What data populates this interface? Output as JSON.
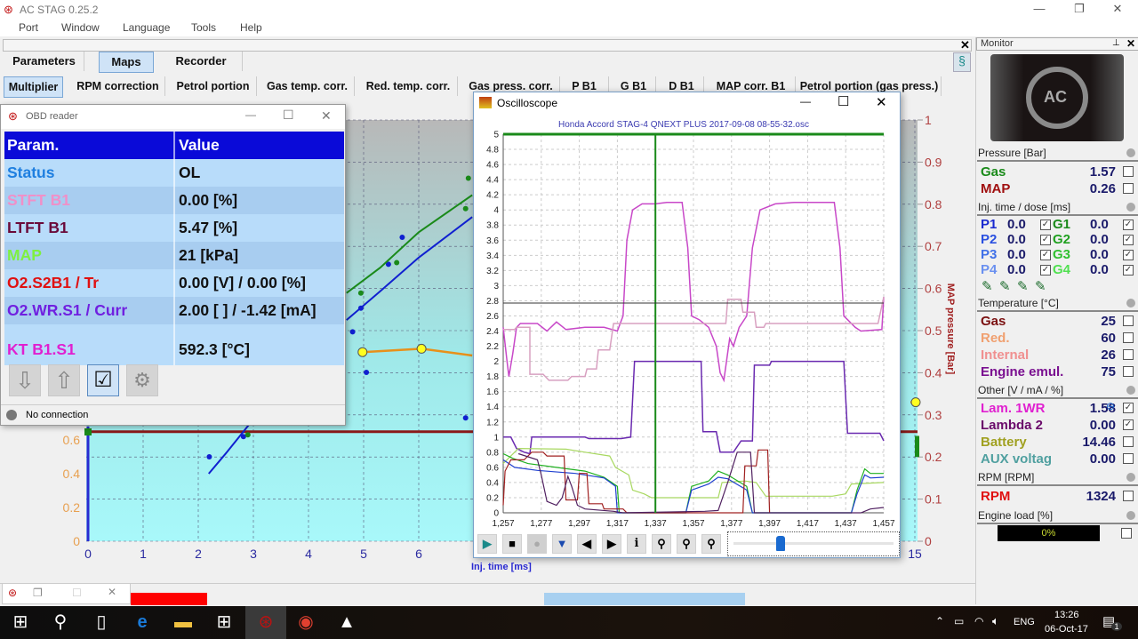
{
  "app": {
    "title": "AC STAG 0.25.2",
    "menu": [
      "Port",
      "Window",
      "Language",
      "Tools",
      "Help"
    ]
  },
  "tabs": [
    {
      "label": "Parameters"
    },
    {
      "label": "Maps",
      "selected": true
    },
    {
      "label": "Recorder"
    }
  ],
  "subtabs": [
    {
      "label": "Multiplier",
      "selected": true
    },
    {
      "label": "RPM correction"
    },
    {
      "label": "Petrol portion"
    },
    {
      "label": "Gas temp. corr."
    },
    {
      "label": "Red. temp. corr."
    },
    {
      "label": "Gas press. corr."
    },
    {
      "label": "P B1"
    },
    {
      "label": "G B1"
    },
    {
      "label": "D B1"
    },
    {
      "label": "MAP corr. B1"
    },
    {
      "label": "Petrol portion (gas press.)"
    }
  ],
  "map_chart": {
    "type": "scatter",
    "xlabel": "Inj. time [ms]",
    "y2label": "MAP pressure [Bar]",
    "xlim": [
      0,
      15
    ],
    "y2lim": [
      0,
      1
    ],
    "x_ticks": [
      "0",
      "1",
      "2",
      "3",
      "4",
      "5",
      "6",
      "15"
    ],
    "y_ticks": [
      "0",
      "0.2",
      "0.4",
      "0.6"
    ],
    "y2_ticks": [
      "0",
      "0.1",
      "0.2",
      "0.3",
      "0.4",
      "0.5",
      "0.6",
      "0.7",
      "0.8",
      "0.9",
      "1"
    ],
    "green_curve": [
      [
        4.69,
        1.47
      ],
      [
        5.3,
        1.62
      ],
      [
        6.0,
        1.83
      ],
      [
        6.97,
        2.05
      ]
    ],
    "blue_curve": [
      [
        4.69,
        1.31
      ],
      [
        5.3,
        1.48
      ],
      [
        6.0,
        1.68
      ],
      [
        6.97,
        1.92
      ]
    ],
    "blue_low_curve": [
      [
        2.19,
        0.4
      ],
      [
        2.5,
        0.52
      ],
      [
        2.92,
        0.69
      ]
    ],
    "orange_curve": [
      [
        4.98,
        1.12
      ],
      [
        6.05,
        1.14
      ],
      [
        6.97,
        1.1
      ]
    ],
    "orange_points": [
      [
        4.98,
        1.12
      ],
      [
        6.05,
        1.14
      ]
    ],
    "map_level_bar": 0.26,
    "right_marker": {
      "map": 0.33
    },
    "points_blue": [
      [
        2.2,
        0.5
      ],
      [
        2.82,
        0.62
      ],
      [
        5.7,
        1.8
      ],
      [
        5.45,
        1.64
      ],
      [
        4.95,
        1.38
      ],
      [
        5.05,
        1.0
      ],
      [
        4.8,
        1.24
      ],
      [
        6.85,
        0.73
      ]
    ],
    "points_green": [
      [
        5.6,
        1.65
      ],
      [
        6.9,
        2.15
      ],
      [
        6.85,
        1.97
      ],
      [
        4.95,
        1.47
      ],
      [
        2.9,
        0.63
      ]
    ],
    "colors": {
      "green": "#1a8a1a",
      "blue": "#1020d0",
      "orange": "#e8901a",
      "yellow": "#ffff20",
      "map_line": "#8a1a1a"
    }
  },
  "obd": {
    "title": "OBD reader",
    "headers": [
      "Param.",
      "Value"
    ],
    "rows": [
      {
        "param": "Status",
        "value": "OL",
        "color": "#1e7fe0"
      },
      {
        "param": "STFT B1",
        "value": "0.00 [%]",
        "color": "#f090c8"
      },
      {
        "param": "LTFT B1",
        "value": "5.47 [%]",
        "color": "#6a0a3a"
      },
      {
        "param": "MAP",
        "value": "21 [kPa]",
        "color": "#7ef040"
      },
      {
        "param": "O2.S2B1 / Tr",
        "value": "0.00 [V] / 0.00 [%]",
        "color": "#e01010"
      },
      {
        "param": "O2.WR.S1 / Curr",
        "value": "2.00 [ ] / -1.42 [mA]",
        "color": "#7020e0"
      },
      {
        "param": "KT B1.S1",
        "value": "592.3 [°C]",
        "color": "#e020d0"
      }
    ],
    "status": "No connection"
  },
  "osc": {
    "title": "Oscilloscope",
    "chart_title": "Honda Accord STAG-4 QNEXT PLUS 2017-09-08 08-55-32.osc",
    "slider_value": 0.28
  },
  "chart_data": {
    "type": "line",
    "title": "Honda Accord STAG-4 QNEXT PLUS 2017-09-08 08-55-32.osc",
    "xlim": [
      1257,
      1457
    ],
    "ylim": [
      0,
      5
    ],
    "grid": true,
    "x_ticks": [
      "1,257",
      "1,277",
      "1,297",
      "1,317",
      "1,337",
      "1,357",
      "1,377",
      "1,397",
      "1,417",
      "1,437",
      "1,457"
    ],
    "y_ticks": [
      "0",
      "0.2",
      "0.4",
      "0.6",
      "0.8",
      "1",
      "1.2",
      "1.4",
      "1.6",
      "1.8",
      "2",
      "2.2",
      "2.4",
      "2.6",
      "2.8",
      "3",
      "3.2",
      "3.4",
      "3.6",
      "3.8",
      "4",
      "4.2",
      "4.4",
      "4.6",
      "4.8",
      "5"
    ],
    "cursor_x": 1337,
    "cursor_y": 2.77,
    "series": [
      {
        "color": "#c848c8",
        "points": [
          [
            1257,
            2.45
          ],
          [
            1259,
            2.0
          ],
          [
            1260,
            1.8
          ],
          [
            1262,
            2.1
          ],
          [
            1264,
            2.45
          ],
          [
            1266,
            2.5
          ],
          [
            1275,
            2.5
          ],
          [
            1280,
            2.4
          ],
          [
            1285,
            2.52
          ],
          [
            1290,
            2.42
          ],
          [
            1300,
            2.45
          ],
          [
            1310,
            2.45
          ],
          [
            1317,
            2.4
          ],
          [
            1320,
            2.6
          ],
          [
            1322,
            3.6
          ],
          [
            1325,
            4.0
          ],
          [
            1330,
            4.08
          ],
          [
            1337,
            4.08
          ],
          [
            1343,
            4.1
          ],
          [
            1351,
            4.1
          ],
          [
            1354,
            3.5
          ],
          [
            1356,
            2.6
          ],
          [
            1360,
            2.55
          ],
          [
            1365,
            2.45
          ],
          [
            1369,
            2.2
          ],
          [
            1371,
            1.85
          ],
          [
            1373,
            1.75
          ],
          [
            1376,
            2.3
          ],
          [
            1378,
            2.2
          ],
          [
            1381,
            2.45
          ],
          [
            1385,
            2.6
          ],
          [
            1388,
            3.5
          ],
          [
            1392,
            4.0
          ],
          [
            1400,
            4.08
          ],
          [
            1410,
            4.1
          ],
          [
            1425,
            4.1
          ],
          [
            1431,
            4.1
          ],
          [
            1434,
            3.5
          ],
          [
            1436,
            2.6
          ],
          [
            1438,
            2.55
          ],
          [
            1442,
            2.45
          ],
          [
            1445,
            2.4
          ],
          [
            1456,
            2.42
          ],
          [
            1457,
            2.85
          ]
        ]
      },
      {
        "color": "#d8a0c0",
        "points": [
          [
            1257,
            2.42
          ],
          [
            1263,
            2.42
          ],
          [
            1264,
            2.45
          ],
          [
            1271,
            2.45
          ],
          [
            1271,
            1.83
          ],
          [
            1278,
            1.83
          ],
          [
            1281,
            1.75
          ],
          [
            1291,
            1.75
          ],
          [
            1293,
            1.8
          ],
          [
            1300,
            1.8
          ],
          [
            1301,
            1.9
          ],
          [
            1306,
            1.9
          ],
          [
            1307,
            2.15
          ],
          [
            1313,
            2.15
          ],
          [
            1315,
            2.5
          ],
          [
            1374,
            2.5
          ],
          [
            1375,
            2.82
          ],
          [
            1382,
            2.82
          ],
          [
            1383,
            2.65
          ],
          [
            1389,
            2.65
          ],
          [
            1390,
            2.45
          ],
          [
            1394,
            2.45
          ],
          [
            1395,
            2.5
          ],
          [
            1454,
            2.5
          ],
          [
            1457,
            2.85
          ]
        ]
      },
      {
        "color": "#6a2ab0",
        "points": [
          [
            1257,
            1.0
          ],
          [
            1261,
            1.0
          ],
          [
            1264,
            0.85
          ],
          [
            1268,
            0.8
          ],
          [
            1271,
            0.78
          ],
          [
            1272,
            1.0
          ],
          [
            1300,
            1.0
          ],
          [
            1302,
            0.98
          ],
          [
            1319,
            0.98
          ],
          [
            1324,
            1.0
          ],
          [
            1326,
            2.0
          ],
          [
            1361,
            2.0
          ],
          [
            1362,
            1.07
          ],
          [
            1369,
            1.07
          ],
          [
            1371,
            0.8
          ],
          [
            1378,
            0.8
          ],
          [
            1382,
            0.95
          ],
          [
            1388,
            0.95
          ],
          [
            1389,
            1.95
          ],
          [
            1397,
            1.95
          ],
          [
            1398,
            2.0
          ],
          [
            1436,
            2.0
          ],
          [
            1438,
            1.05
          ],
          [
            1455,
            1.05
          ],
          [
            1457,
            0.95
          ]
        ]
      },
      {
        "color": "#a8d860",
        "points": [
          [
            1257,
            0.65
          ],
          [
            1265,
            0.85
          ],
          [
            1290,
            0.84
          ],
          [
            1300,
            0.8
          ],
          [
            1313,
            0.75
          ],
          [
            1316,
            0.6
          ],
          [
            1323,
            0.5
          ],
          [
            1325,
            0.3
          ],
          [
            1331,
            0.25
          ],
          [
            1335,
            0.2
          ],
          [
            1370,
            0.2
          ],
          [
            1372,
            0.4
          ],
          [
            1384,
            0.42
          ],
          [
            1390,
            0.4
          ],
          [
            1395,
            0.22
          ],
          [
            1430,
            0.22
          ],
          [
            1437,
            0.25
          ],
          [
            1440,
            0.38
          ],
          [
            1457,
            0.4
          ]
        ]
      },
      {
        "color": "#20b020",
        "points": [
          [
            1257,
            0.78
          ],
          [
            1262,
            0.72
          ],
          [
            1270,
            0.65
          ],
          [
            1285,
            0.6
          ],
          [
            1300,
            0.55
          ],
          [
            1310,
            0.47
          ],
          [
            1317,
            0.35
          ],
          [
            1318,
            0
          ],
          [
            1353,
            0
          ],
          [
            1356,
            0.35
          ],
          [
            1365,
            0.42
          ],
          [
            1370,
            0.55
          ],
          [
            1375,
            0.5
          ],
          [
            1385,
            0.35
          ],
          [
            1388,
            0
          ],
          [
            1440,
            0
          ],
          [
            1443,
            0.3
          ],
          [
            1447,
            0.58
          ],
          [
            1450,
            0.52
          ],
          [
            1457,
            0.52
          ]
        ]
      },
      {
        "color": "#2040d0",
        "points": [
          [
            1257,
            0.7
          ],
          [
            1263,
            0.6
          ],
          [
            1275,
            0.56
          ],
          [
            1295,
            0.52
          ],
          [
            1310,
            0.46
          ],
          [
            1316,
            0.35
          ],
          [
            1317,
            0
          ],
          [
            1353,
            0
          ],
          [
            1356,
            0.3
          ],
          [
            1365,
            0.38
          ],
          [
            1370,
            0.47
          ],
          [
            1375,
            0.45
          ],
          [
            1385,
            0.3
          ],
          [
            1388,
            0
          ],
          [
            1440,
            0
          ],
          [
            1443,
            0.25
          ],
          [
            1447,
            0.5
          ],
          [
            1450,
            0.46
          ],
          [
            1457,
            0.47
          ]
        ]
      },
      {
        "color": "#a02020",
        "points": [
          [
            1257,
            0.1
          ],
          [
            1258,
            0.55
          ],
          [
            1261,
            0.7
          ],
          [
            1268,
            0.7
          ],
          [
            1272,
            0.8
          ],
          [
            1278,
            0.8
          ],
          [
            1280,
            0.75
          ],
          [
            1289,
            0.75
          ],
          [
            1290,
            0.17
          ],
          [
            1296,
            0.17
          ],
          [
            1297,
            0.52
          ],
          [
            1301,
            0.52
          ],
          [
            1302,
            0.12
          ],
          [
            1309,
            0.12
          ],
          [
            1310,
            0.05
          ],
          [
            1320,
            0.05
          ],
          [
            1322,
            0
          ],
          [
            1383,
            0
          ],
          [
            1384,
            0.62
          ],
          [
            1390,
            0.62
          ],
          [
            1391,
            0.83
          ],
          [
            1396,
            0.83
          ],
          [
            1397,
            0
          ]
        ]
      },
      {
        "color": "#502060",
        "points": [
          [
            1265,
            0.78
          ],
          [
            1275,
            0.7
          ],
          [
            1277,
            0.5
          ],
          [
            1280,
            0.15
          ],
          [
            1285,
            0.1
          ],
          [
            1288,
            0.2
          ],
          [
            1291,
            0.48
          ],
          [
            1293,
            0.35
          ],
          [
            1296,
            0.1
          ],
          [
            1300,
            0.05
          ],
          [
            1315,
            0.02
          ],
          [
            1320,
            0
          ],
          [
            1363,
            0.02
          ],
          [
            1370,
            0.03
          ],
          [
            1375,
            0.4
          ],
          [
            1380,
            0.8
          ],
          [
            1387,
            0.8
          ],
          [
            1389,
            0
          ],
          [
            1445,
            0
          ],
          [
            1450,
            0.05
          ],
          [
            1457,
            0.07
          ]
        ]
      }
    ]
  },
  "monitor": {
    "title": "Monitor",
    "pressure": {
      "header": "Pressure [Bar]",
      "rows": [
        {
          "label": "Gas",
          "value": "1.57",
          "color": "#1a8a1a",
          "checked": false
        },
        {
          "label": "MAP",
          "value": "0.26",
          "color": "#a01010",
          "checked": false
        }
      ]
    },
    "inj": {
      "header": "Inj. time / dose [ms]",
      "rows": [
        {
          "p": "P1",
          "pv": "0.0",
          "g": "G1",
          "gv": "0.0",
          "pc": "#1a2ad0",
          "gc": "#1a8a1a"
        },
        {
          "p": "P2",
          "pv": "0.0",
          "g": "G2",
          "gv": "0.0",
          "pc": "#2a50e0",
          "gc": "#20a020"
        },
        {
          "p": "P3",
          "pv": "0.0",
          "g": "G3",
          "gv": "0.0",
          "pc": "#4070e8",
          "gc": "#30c030"
        },
        {
          "p": "P4",
          "pv": "0.0",
          "g": "G4",
          "gv": "0.0",
          "pc": "#6a90f0",
          "gc": "#50e050"
        }
      ]
    },
    "temp": {
      "header": "Temperature [°C]",
      "rows": [
        {
          "label": "Gas",
          "value": "25",
          "color": "#7a1010",
          "checked": false
        },
        {
          "label": "Red.",
          "value": "60",
          "color": "#f0a070",
          "checked": false
        },
        {
          "label": "Internal",
          "value": "26",
          "color": "#f09090",
          "checked": false
        },
        {
          "label": "Engine emul.",
          "value": "75",
          "color": "#7a1090",
          "checked": false
        }
      ]
    },
    "other": {
      "header": "Other [V / mA / %]",
      "rows": [
        {
          "label": "Lam. 1WR",
          "value": "1.58",
          "color": "#e020d0",
          "checked": true
        },
        {
          "label": "Lambda 2",
          "value": "0.00",
          "color": "#6a0a6a",
          "checked": true
        },
        {
          "label": "Battery",
          "value": "14.46",
          "color": "#a0a020",
          "checked": false
        },
        {
          "label": "AUX voltag",
          "value": "0.00",
          "color": "#50a0a0",
          "checked": false
        }
      ]
    },
    "rpm": {
      "header": "RPM [RPM]",
      "rows": [
        {
          "label": "RPM",
          "value": "1324",
          "color": "#e01010",
          "checked": false
        }
      ]
    },
    "load": {
      "header": "Engine load [%]",
      "value": "0%",
      "percent": 0
    }
  },
  "taskbar": {
    "time": "13:26",
    "date": "06-Oct-17",
    "lang": "ENG",
    "notifications": "1"
  }
}
